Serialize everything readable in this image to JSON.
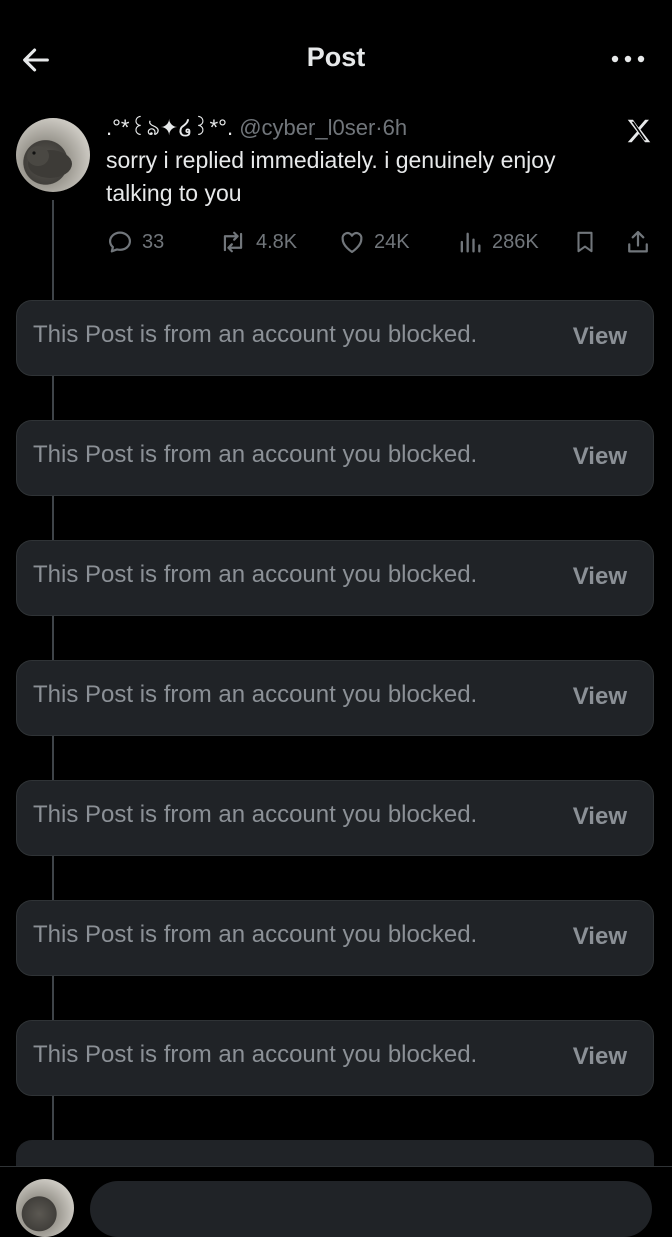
{
  "header": {
    "title": "Post",
    "back_icon": "arrow-left-icon",
    "more_icon": "more-horizontal-icon"
  },
  "tweet": {
    "display_name": ".°*꒰ঌ✦໒꒱*°.",
    "handle": "@cyber_l0ser",
    "separator": "·",
    "time": "6h",
    "text": "sorry i replied immediately. i genuinely enjoy talking to you",
    "stats": {
      "replies": "33",
      "reposts": "4.8K",
      "likes": "24K",
      "views": "286K"
    }
  },
  "blocked_posts": [
    {
      "text": "This Post is from an account you blocked.",
      "action": "View"
    },
    {
      "text": "This Post is from an account you blocked.",
      "action": "View"
    },
    {
      "text": "This Post is from an account you blocked.",
      "action": "View"
    },
    {
      "text": "This Post is from an account you blocked.",
      "action": "View"
    },
    {
      "text": "This Post is from an account you blocked.",
      "action": "View"
    },
    {
      "text": "This Post is from an account you blocked.",
      "action": "View"
    },
    {
      "text": "This Post is from an account you blocked.",
      "action": "View"
    }
  ],
  "colors": {
    "background": "#000000",
    "card": "#202327",
    "muted_text": "#71767b",
    "primary_text": "#e7e9ea"
  }
}
